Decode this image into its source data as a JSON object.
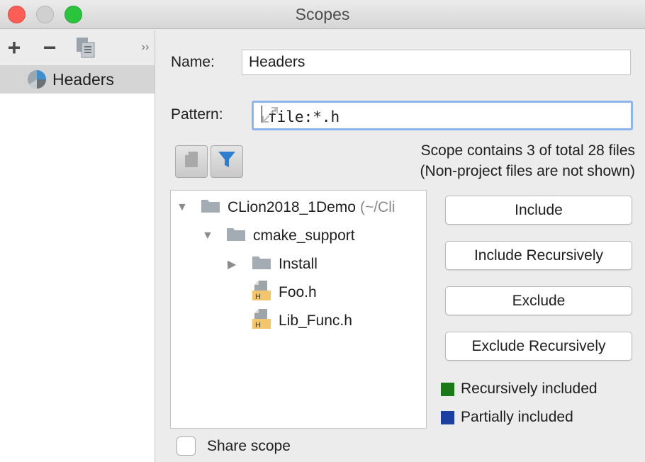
{
  "window": {
    "title": "Scopes"
  },
  "sidebar": {
    "items": [
      {
        "label": "Headers",
        "icon": "scope-pie-icon"
      }
    ]
  },
  "form": {
    "name_label": "Name:",
    "name_value": "Headers",
    "pattern_label": "Pattern:",
    "pattern_value": "file:*.h"
  },
  "info": {
    "line1": "Scope contains 3 of total 28 files",
    "line2": "(Non-project files are not shown)"
  },
  "tree": {
    "root": {
      "label": "CLion2018_1Demo",
      "hint": "(~/Cli"
    },
    "cmake_support": {
      "label": "cmake_support"
    },
    "install": {
      "label": "Install"
    },
    "foo": {
      "label": "Foo.h"
    },
    "lib_func": {
      "label": "Lib_Func.h"
    }
  },
  "buttons": {
    "include": "Include",
    "include_recursively": "Include Recursively",
    "exclude": "Exclude",
    "exclude_recursively": "Exclude Recursively"
  },
  "legend": {
    "recursive": {
      "label": "Recursively included",
      "color": "#1a7a1a"
    },
    "partial": {
      "label": "Partially included",
      "color": "#1b3fa3"
    }
  },
  "share": {
    "label": "Share scope",
    "checked": false
  },
  "colors": {
    "accent_focus": "#8bb5ec",
    "selection": "#d5d5d5"
  }
}
